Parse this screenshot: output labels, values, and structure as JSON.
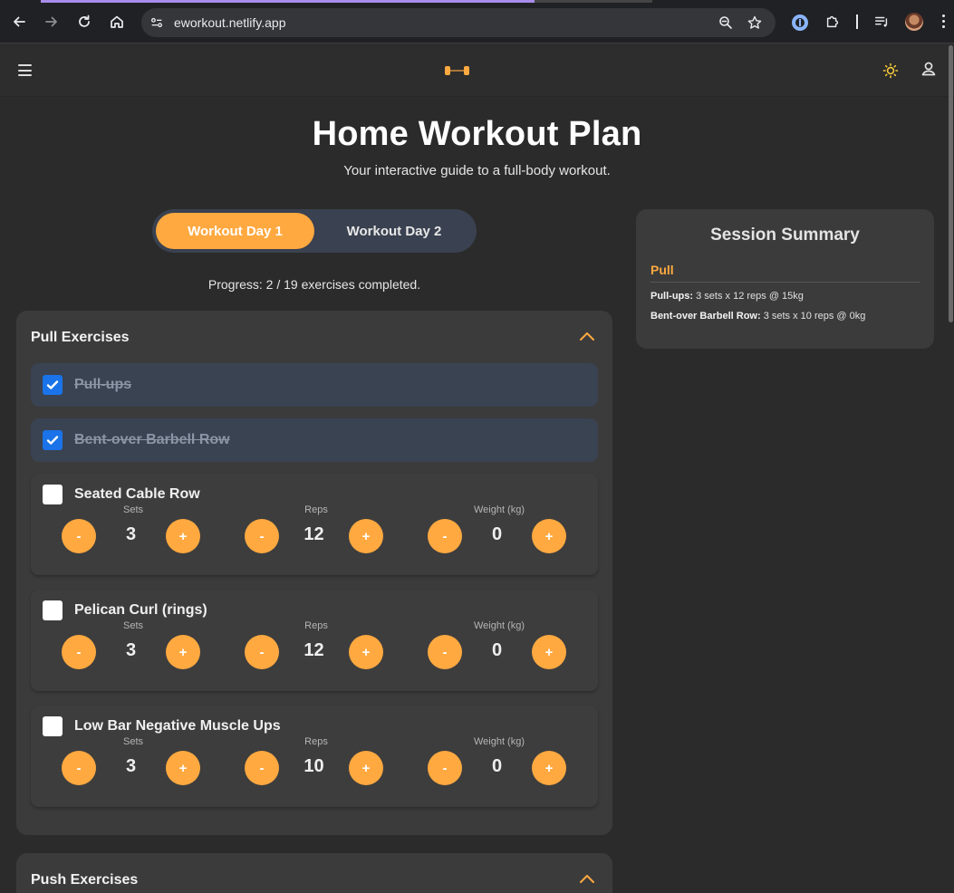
{
  "browser": {
    "url": "eworkout.netlify.app"
  },
  "page": {
    "title": "Home Workout Plan",
    "subtitle": "Your interactive guide to a full-body workout."
  },
  "tabs": [
    {
      "label": "Workout Day 1",
      "active": true
    },
    {
      "label": "Workout Day 2",
      "active": false
    }
  ],
  "progress_text": "Progress: 2 / 19 exercises completed.",
  "sections": [
    {
      "title": "Pull Exercises",
      "expanded": true,
      "exercises": [
        {
          "name": "Pull-ups",
          "done": true
        },
        {
          "name": "Bent-over Barbell Row",
          "done": true
        },
        {
          "name": "Seated Cable Row",
          "done": false,
          "sets": "3",
          "reps": "12",
          "weight": "0"
        },
        {
          "name": "Pelican Curl (rings)",
          "done": false,
          "sets": "3",
          "reps": "12",
          "weight": "0"
        },
        {
          "name": "Low Bar Negative Muscle Ups",
          "done": false,
          "sets": "3",
          "reps": "10",
          "weight": "0"
        }
      ]
    },
    {
      "title": "Push Exercises",
      "expanded": true
    }
  ],
  "stepper_labels": {
    "sets": "Sets",
    "reps": "Reps",
    "weight": "Weight (kg)",
    "minus": "-",
    "plus": "+"
  },
  "summary": {
    "title": "Session Summary",
    "category": "Pull",
    "items": [
      {
        "name": "Pull-ups:",
        "detail": "3 sets x 12 reps @ 15kg"
      },
      {
        "name": "Bent-over Barbell Row:",
        "detail": "3 sets x 10 reps @ 0kg"
      }
    ]
  },
  "colors": {
    "accent": "#ffa940",
    "checkbox": "#1a73e8",
    "background": "#2b2b2b",
    "card": "#3b3b3b"
  }
}
